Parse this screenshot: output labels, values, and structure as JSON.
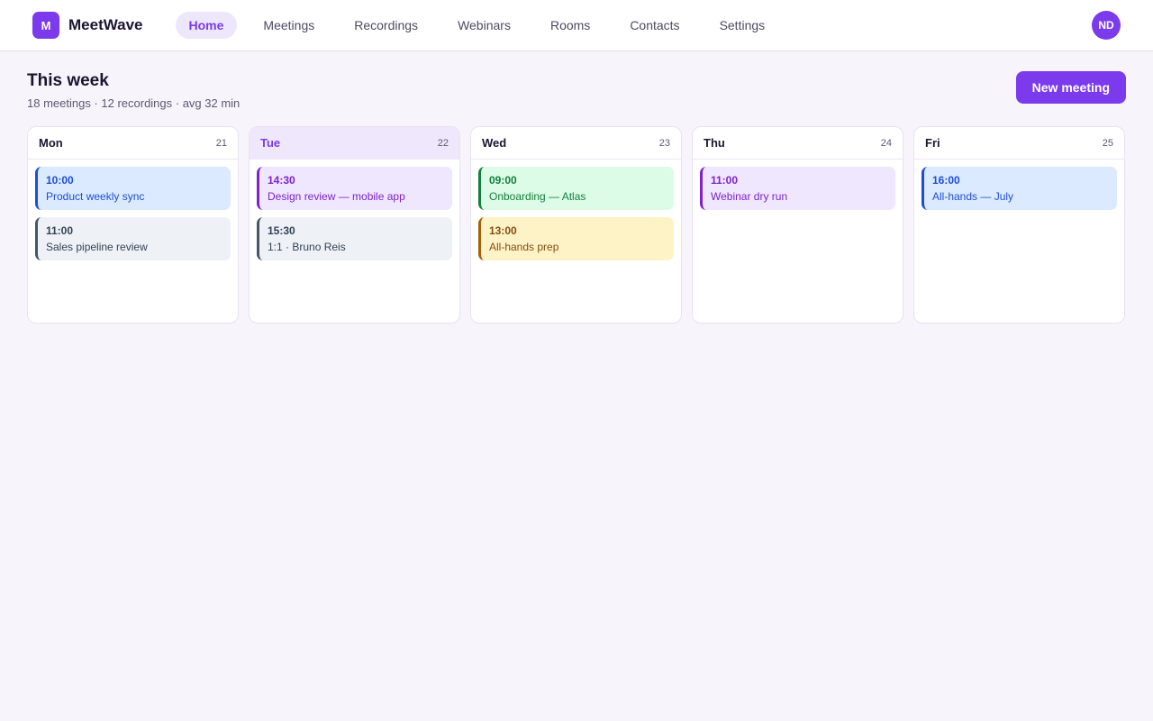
{
  "app": {
    "logo_letter": "M",
    "name": "MeetWave"
  },
  "nav": [
    {
      "label": "Home",
      "active": true
    },
    {
      "label": "Meetings",
      "active": false
    },
    {
      "label": "Recordings",
      "active": false
    },
    {
      "label": "Webinars",
      "active": false
    },
    {
      "label": "Rooms",
      "active": false
    },
    {
      "label": "Contacts",
      "active": false
    },
    {
      "label": "Settings",
      "active": false
    }
  ],
  "user": {
    "initials": "ND"
  },
  "header": {
    "title": "This week",
    "subtitle": "18 meetings · 12 recordings · avg 32 min",
    "new_button": "New meeting"
  },
  "colors": {
    "accent": "#7c3aed",
    "blue": "#1d4ed8",
    "gray": "#475569",
    "purple": "#7e22ce",
    "green": "#15803d",
    "yellow": "#a16207"
  },
  "days": [
    {
      "name": "Mon",
      "date": "21",
      "today": false,
      "events": [
        {
          "time": "10:00",
          "title": "Product weekly sync",
          "color": "blue"
        },
        {
          "time": "11:00",
          "title": "Sales pipeline review",
          "color": "gray"
        }
      ]
    },
    {
      "name": "Tue",
      "date": "22",
      "today": true,
      "events": [
        {
          "time": "14:30",
          "title": "Design review — mobile app",
          "color": "purple"
        },
        {
          "time": "15:30",
          "title": "1:1 · Bruno Reis",
          "color": "gray"
        }
      ]
    },
    {
      "name": "Wed",
      "date": "23",
      "today": false,
      "events": [
        {
          "time": "09:00",
          "title": "Onboarding — Atlas",
          "color": "green"
        },
        {
          "time": "13:00",
          "title": "All-hands prep",
          "color": "yellow"
        }
      ]
    },
    {
      "name": "Thu",
      "date": "24",
      "today": false,
      "events": [
        {
          "time": "11:00",
          "title": "Webinar dry run",
          "color": "purple"
        }
      ]
    },
    {
      "name": "Fri",
      "date": "25",
      "today": false,
      "events": [
        {
          "time": "16:00",
          "title": "All-hands — July",
          "color": "blue"
        }
      ]
    }
  ]
}
